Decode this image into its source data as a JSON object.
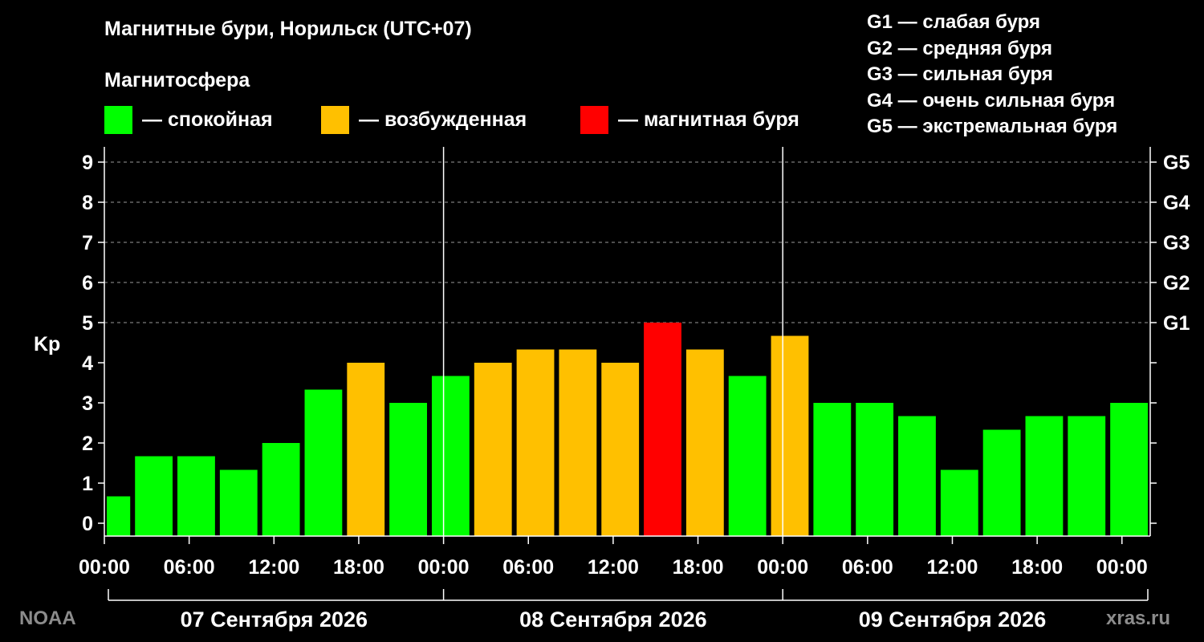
{
  "title": "Магнитные бури, Норильск (UTC+07)",
  "subtitle": "Магнитосфера",
  "legend": [
    {
      "label": "— спокойная",
      "color": "#00ff00"
    },
    {
      "label": "— возбужденная",
      "color": "#ffc000"
    },
    {
      "label": "— магнитная буря",
      "color": "#ff0000"
    }
  ],
  "g_levels": [
    "G1 — слабая буря",
    "G2 — средняя буря",
    "G3 — сильная буря",
    "G4 — очень сильная буря",
    "G5 — экстремальная буря"
  ],
  "source_left": "NOAA",
  "source_right": "xras.ru",
  "chart_data": {
    "type": "bar",
    "ylabel": "Kp",
    "ylim": [
      0,
      9
    ],
    "y_ticks": [
      "0",
      "1",
      "2",
      "3",
      "4",
      "5",
      "6",
      "7",
      "8",
      "9"
    ],
    "right_axis_labels": [
      {
        "label": "G1",
        "kp": 5
      },
      {
        "label": "G2",
        "kp": 6
      },
      {
        "label": "G3",
        "kp": 7
      },
      {
        "label": "G4",
        "kp": 8
      },
      {
        "label": "G5",
        "kp": 9
      }
    ],
    "x_tick_labels": [
      "00:00",
      "06:00",
      "12:00",
      "18:00",
      "00:00",
      "06:00",
      "12:00",
      "18:00",
      "00:00",
      "06:00",
      "12:00",
      "18:00",
      "00:00"
    ],
    "day_labels": [
      "07 Сентября 2026",
      "08 Сентября 2026",
      "09 Сентября 2026"
    ],
    "grid": true,
    "bars": [
      {
        "hours": 2,
        "value": 0.67,
        "status": "calm"
      },
      {
        "hours": 3,
        "value": 1.67,
        "status": "calm"
      },
      {
        "hours": 3,
        "value": 1.67,
        "status": "calm"
      },
      {
        "hours": 3,
        "value": 1.33,
        "status": "calm"
      },
      {
        "hours": 3,
        "value": 2.0,
        "status": "calm"
      },
      {
        "hours": 3,
        "value": 3.33,
        "status": "calm"
      },
      {
        "hours": 3,
        "value": 4.0,
        "status": "active"
      },
      {
        "hours": 3,
        "value": 3.0,
        "status": "calm"
      },
      {
        "hours": 3,
        "value": 3.67,
        "status": "calm"
      },
      {
        "hours": 3,
        "value": 4.0,
        "status": "active"
      },
      {
        "hours": 3,
        "value": 4.33,
        "status": "active"
      },
      {
        "hours": 3,
        "value": 4.33,
        "status": "active"
      },
      {
        "hours": 3,
        "value": 4.0,
        "status": "active"
      },
      {
        "hours": 3,
        "value": 5.0,
        "status": "storm"
      },
      {
        "hours": 3,
        "value": 4.33,
        "status": "active"
      },
      {
        "hours": 3,
        "value": 3.67,
        "status": "calm"
      },
      {
        "hours": 3,
        "value": 4.67,
        "status": "active"
      },
      {
        "hours": 3,
        "value": 3.0,
        "status": "calm"
      },
      {
        "hours": 3,
        "value": 3.0,
        "status": "calm"
      },
      {
        "hours": 3,
        "value": 2.67,
        "status": "calm"
      },
      {
        "hours": 3,
        "value": 1.33,
        "status": "calm"
      },
      {
        "hours": 3,
        "value": 2.33,
        "status": "calm"
      },
      {
        "hours": 3,
        "value": 2.67,
        "status": "calm"
      },
      {
        "hours": 3,
        "value": 2.67,
        "status": "calm"
      },
      {
        "hours": 3,
        "value": 3.0,
        "status": "calm"
      }
    ],
    "status_colors": {
      "calm": "#00ff00",
      "active": "#ffc000",
      "storm": "#ff0000"
    }
  }
}
